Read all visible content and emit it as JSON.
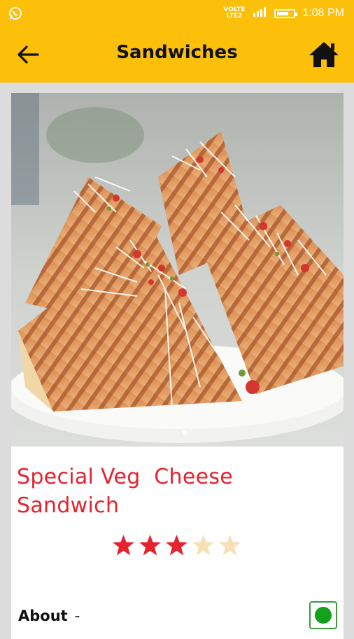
{
  "status_bar": {
    "time": "1:08 PM",
    "sim1_label": "VOLTE",
    "sim1_line2": "LTE2",
    "battery_level": 0.7,
    "notification_icon": "whatsapp-icon"
  },
  "app_bar": {
    "title": "Sandwiches",
    "back_icon": "arrow-left-icon",
    "home_icon": "home-icon"
  },
  "product": {
    "name": "Special Veg  Cheese\nSandwich",
    "rating": 3,
    "rating_max": 5,
    "image_description_icon": "sandwich-photo",
    "carousel_page": 1,
    "carousel_pages": 1
  },
  "about": {
    "label": "About",
    "separator": "-"
  },
  "veg_indicator": {
    "icon": "veg-mark-icon",
    "color": "#13a01c"
  },
  "colors": {
    "accent": "#fcbf0a",
    "title_red": "#e5232f",
    "star_filled": "#e5232f",
    "star_empty": "#f7e0b4"
  }
}
